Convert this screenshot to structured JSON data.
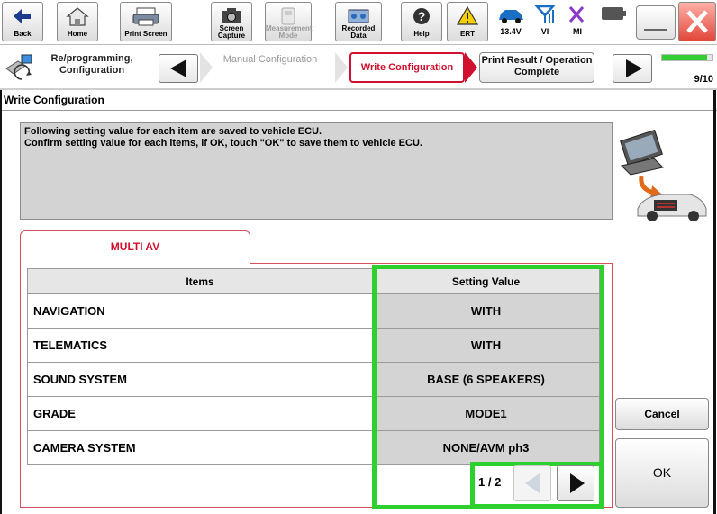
{
  "toolbar": {
    "buttons": [
      {
        "label": "Back",
        "icon": "back-arrow-icon"
      },
      {
        "label": "Home",
        "icon": "home-icon"
      },
      {
        "label": "Print Screen",
        "icon": "printer-icon"
      },
      {
        "label": "Screen Capture",
        "icon": "camera-icon"
      },
      {
        "label": "Measurement Mode",
        "icon": "measurement-icon"
      },
      {
        "label": "Recorded Data",
        "icon": "recorded-data-icon"
      },
      {
        "label": "Help",
        "icon": "help-icon"
      },
      {
        "label": "ERT",
        "icon": "warning-icon"
      }
    ],
    "battery_voltage": "13.4V",
    "vi_label": "VI",
    "mi_label": "MI"
  },
  "stepnav": {
    "steps": [
      {
        "label": "Re/programming, Configuration",
        "state": "done"
      },
      {
        "label": "Manual Configuration",
        "state": "disabled"
      },
      {
        "label": "Write Configuration",
        "state": "current"
      },
      {
        "label": "Print Result / Operation Complete",
        "state": "next"
      }
    ],
    "progress": "9/10",
    "progress_fraction": 0.9
  },
  "page": {
    "title": "Write Configuration",
    "message_line1": "Following setting value for each item are saved to vehicle ECU.",
    "message_line2": "Confirm setting value for each items, if OK, touch \"OK\" to save them to vehicle ECU."
  },
  "tabs": [
    {
      "label": "MULTI AV",
      "active": true
    }
  ],
  "table": {
    "headers": [
      "Items",
      "Setting Value"
    ],
    "rows": [
      {
        "item": "NAVIGATION",
        "value": "WITH"
      },
      {
        "item": "TELEMATICS",
        "value": "WITH"
      },
      {
        "item": "SOUND SYSTEM",
        "value": "BASE (6 SPEAKERS)"
      },
      {
        "item": "GRADE",
        "value": "MODE1"
      },
      {
        "item": "CAMERA SYSTEM",
        "value": "NONE/AVM ph3"
      }
    ]
  },
  "pager": {
    "indicator": "1 / 2"
  },
  "actions": {
    "cancel_label": "Cancel",
    "ok_label": "OK"
  },
  "colors": {
    "accent_red": "#d0102e",
    "highlight_green": "#2ed02e",
    "progress_green": "#33cc33"
  }
}
